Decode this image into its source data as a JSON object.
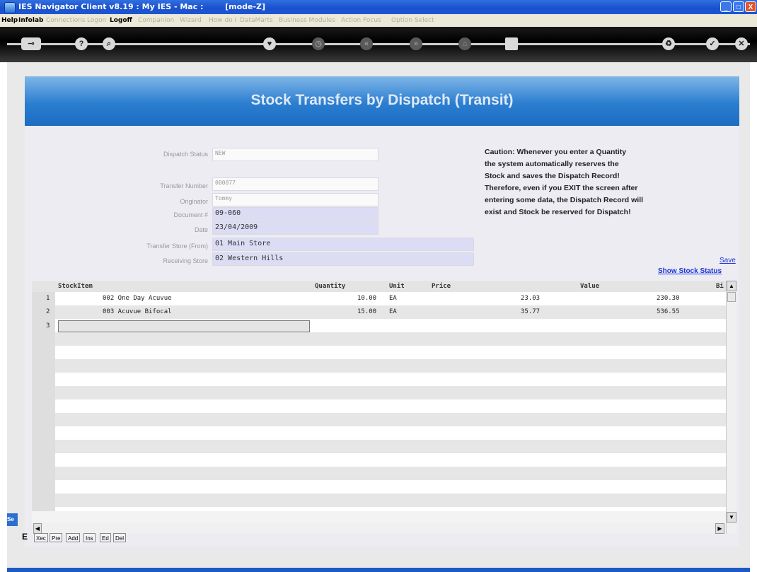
{
  "window": {
    "title": "IES Navigator Client v8.19 : My IES - Mac :        [mode-Z]",
    "controls": {
      "minimize": "_",
      "maximize": "□",
      "close": "X"
    }
  },
  "menu": {
    "items": [
      {
        "label": "Help",
        "enabled": true
      },
      {
        "label": "Infolab",
        "enabled": true
      },
      {
        "label": "Connections",
        "enabled": false
      },
      {
        "label": "Logon",
        "enabled": false
      },
      {
        "label": "Logoff",
        "enabled": true
      },
      {
        "label": "Companion",
        "enabled": false
      },
      {
        "label": "Wizard",
        "enabled": false
      },
      {
        "label": "How do I",
        "enabled": false
      },
      {
        "label": "DataMarts",
        "enabled": false
      },
      {
        "label": "Business Modules",
        "enabled": false
      },
      {
        "label": "Action Focus",
        "enabled": false
      },
      {
        "label": "Option Select",
        "enabled": false
      }
    ]
  },
  "toolbar": {
    "icons": [
      "key-icon",
      "help-icon",
      "search-icon",
      "heart-icon",
      "clock-icon",
      "first-icon",
      "last-icon",
      "tree-icon",
      "stop-icon",
      "recycle-icon",
      "check-icon",
      "close-icon"
    ]
  },
  "page": {
    "title": "Stock Transfers by Dispatch (Transit)"
  },
  "form": {
    "dispatch_status": {
      "label": "Dispatch Status",
      "value": "NEW"
    },
    "transfer_number": {
      "label": "Transfer Number",
      "value": "000077"
    },
    "originator": {
      "label": "Originator",
      "value": "Tommy"
    },
    "document": {
      "label": "Document #",
      "value": "09-060"
    },
    "date": {
      "label": "Date",
      "value": "23/04/2009"
    },
    "transfer_store": {
      "label": "Transfer Store (From)",
      "value": "01 Main Store"
    },
    "receiving_store": {
      "label": "Receiving Store",
      "value": "02 Western Hills"
    }
  },
  "caution": {
    "lines": [
      "Caution: Whenever you enter a Quantity",
      "the system automatically reserves the",
      "Stock and saves the Dispatch Record!",
      "Therefore, even if you EXIT the screen after",
      "entering some data, the Dispatch Record will",
      "exist and Stock be reserved for Dispatch!"
    ]
  },
  "links": {
    "save": "Save",
    "show_stock_status": "Show Stock Status"
  },
  "grid": {
    "columns": [
      "StockItem",
      "Quantity",
      "Unit",
      "Price",
      "Value",
      "Bi"
    ],
    "rows": [
      {
        "num": "1",
        "stock_item": "002 One Day Acuvue",
        "quantity": "10.00",
        "unit": "EA",
        "price": "23.03",
        "value": "230.30"
      },
      {
        "num": "2",
        "stock_item": "003 Acuvue Bifocal",
        "quantity": "15.00",
        "unit": "EA",
        "price": "35.77",
        "value": "536.55"
      },
      {
        "num": "3",
        "stock_item": "",
        "quantity": "",
        "unit": "",
        "price": "",
        "value": ""
      }
    ],
    "nav_buttons": [
      "Xec",
      "Pre",
      "Add",
      "Ins",
      "Ed",
      "Del"
    ]
  },
  "side": {
    "clipped_labels": [
      "Se",
      "E"
    ]
  }
}
